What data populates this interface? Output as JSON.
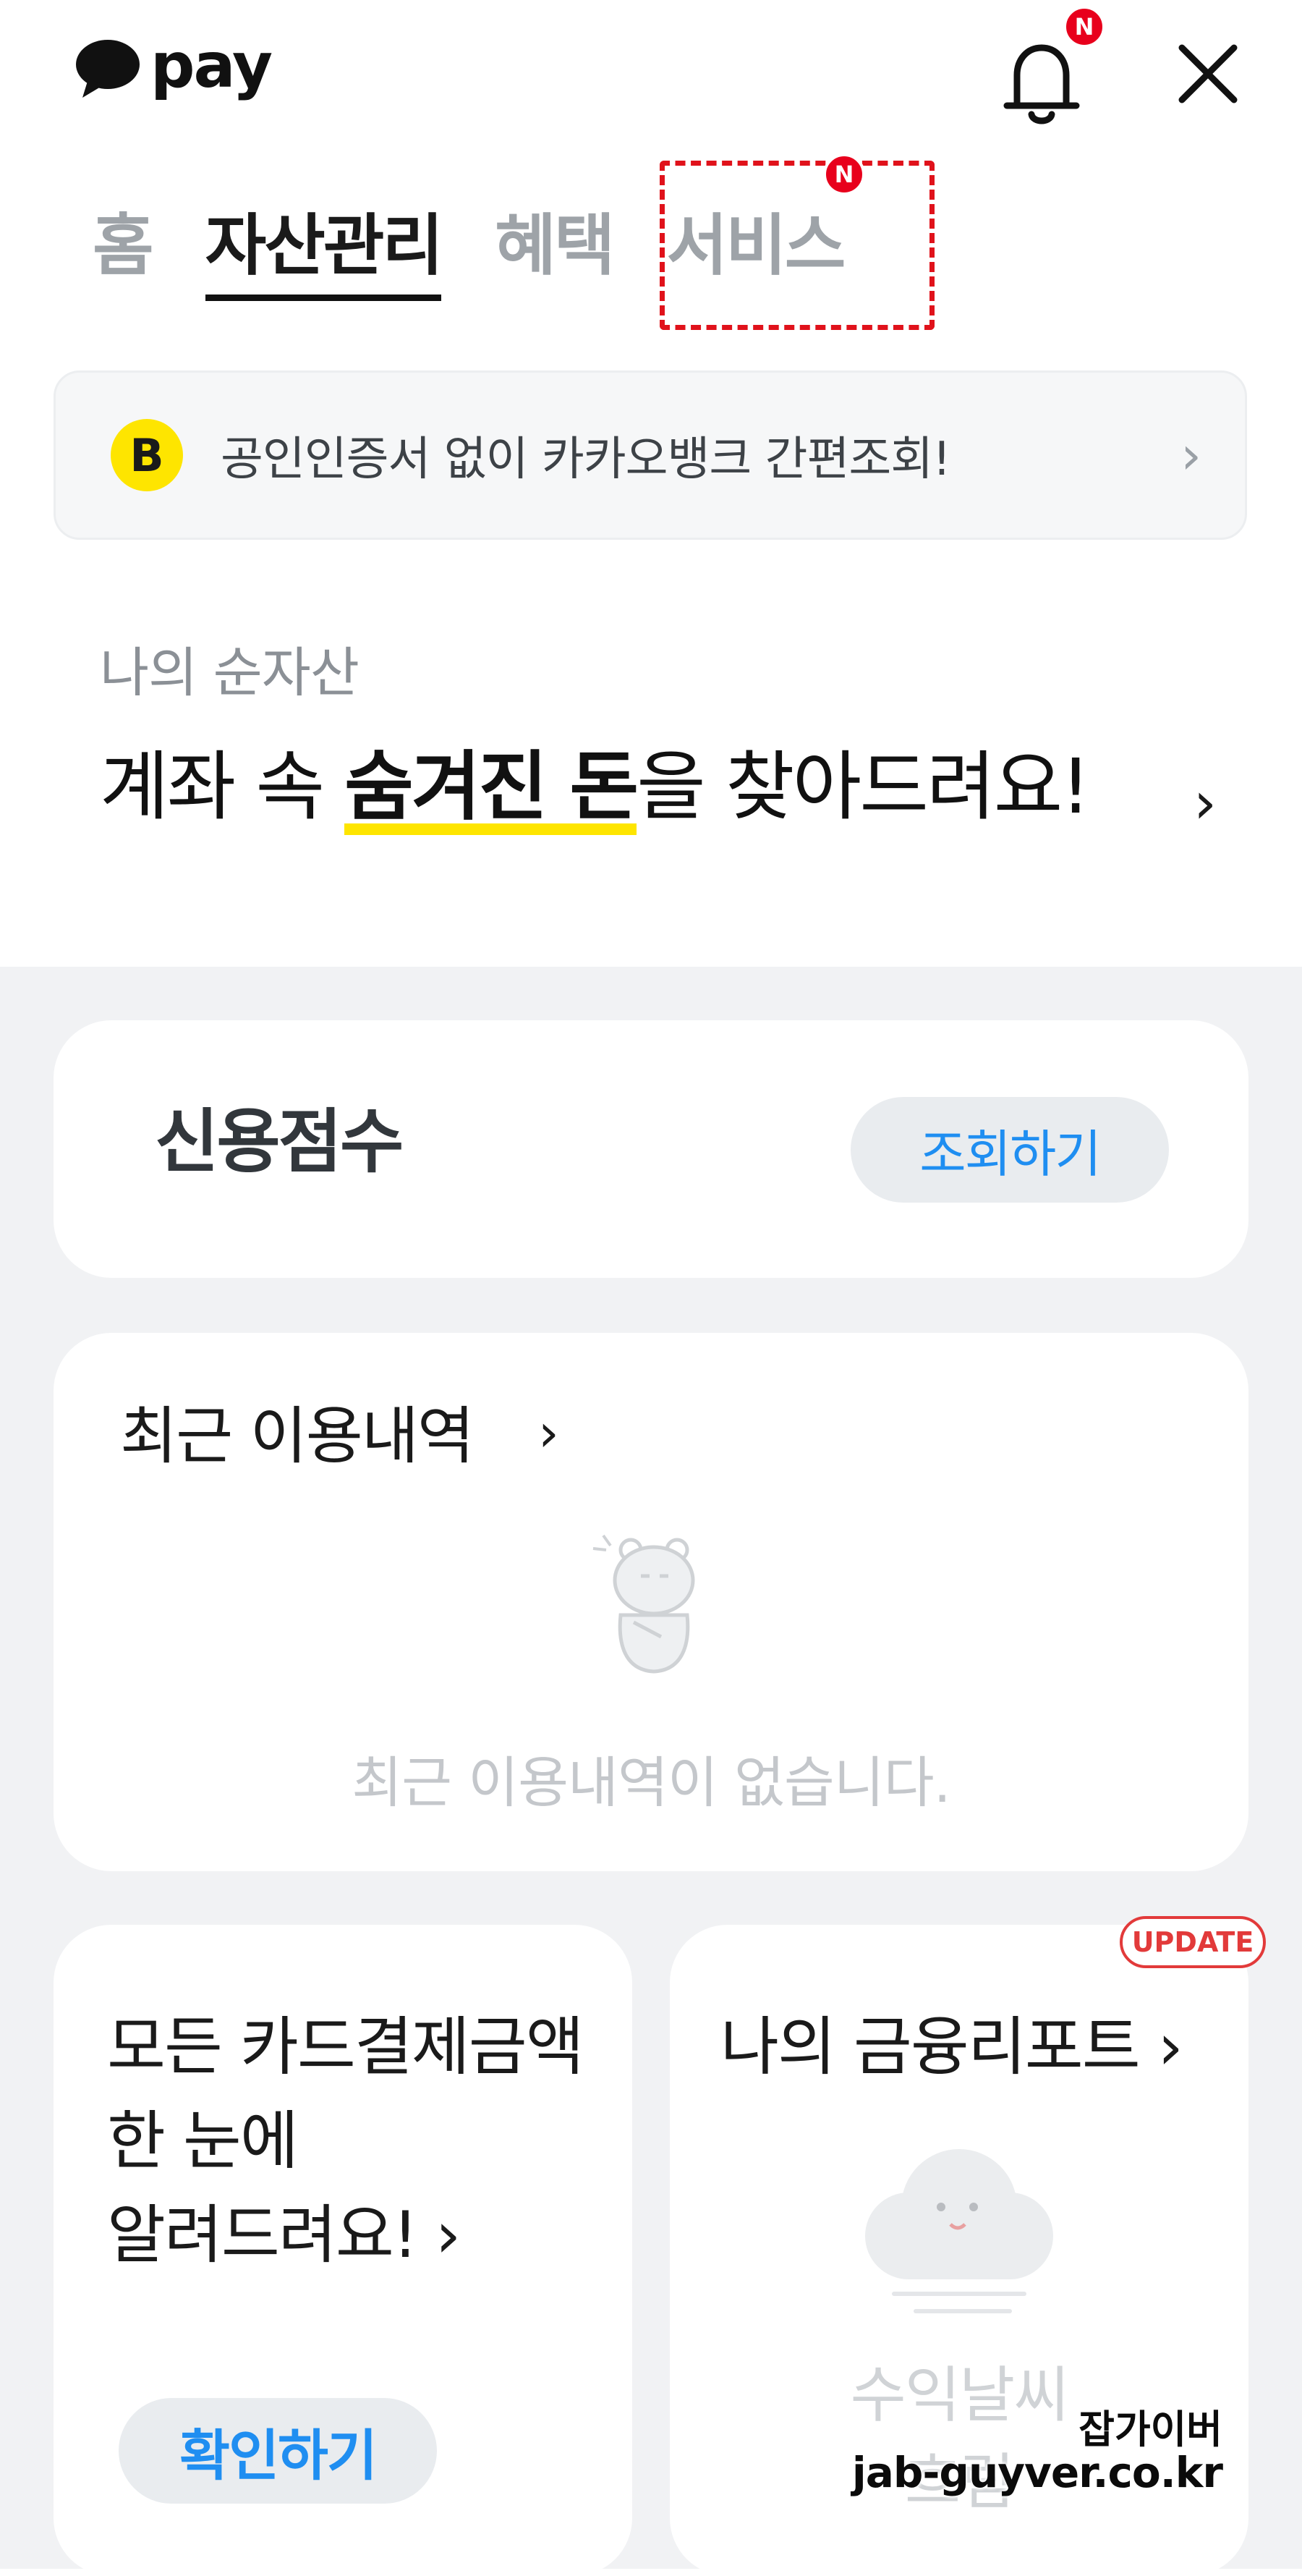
{
  "header": {
    "logo_text": "pay",
    "notification_badge": "N"
  },
  "tabs": [
    {
      "label": "홈",
      "active": false
    },
    {
      "label": "자산관리",
      "active": true
    },
    {
      "label": "혜택",
      "active": false
    },
    {
      "label": "서비스",
      "active": false,
      "badge": "N"
    }
  ],
  "banner": {
    "icon_letter": "B",
    "text": "공인인증서 없이 카카오뱅크 간편조회!"
  },
  "net_assets": {
    "label": "나의 순자산",
    "text_before": "계좌 속 ",
    "text_highlight": "숨겨진 돈",
    "text_after": "을 찾아드려요!"
  },
  "credit": {
    "title": "신용점수",
    "button": "조회하기"
  },
  "recent": {
    "title": "최근 이용내역",
    "empty": "최근 이용내역이 없습니다."
  },
  "card_payment": {
    "line1": "모든 카드결제금액",
    "line2": "한 눈에",
    "line3": "알려드려요!",
    "button": "확인하기"
  },
  "finance_report": {
    "title": "나의 금융리포트",
    "badge": "UPDATE",
    "sub1": "수익날씨",
    "sub2": "흐림"
  },
  "watermark": {
    "line1": "잡가이버",
    "line2": "jab-guyver.co.kr"
  },
  "colors": {
    "kakao_yellow": "#fee500",
    "accent_blue": "#1f8ef1",
    "alert_red": "#e8001c",
    "background_gray": "#f1f2f4"
  }
}
